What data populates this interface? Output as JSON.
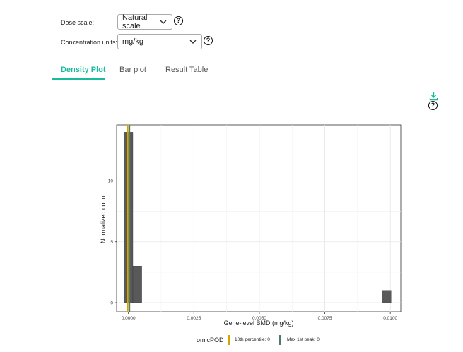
{
  "controls": {
    "dose_scale": {
      "label": "Dose scale:",
      "value": "Natural scale"
    },
    "concentration_units": {
      "label": "Concentration units:",
      "value": "mg/kg"
    },
    "help_glyph": "?"
  },
  "tabs": [
    {
      "label": "Density Plot",
      "active": true
    },
    {
      "label": "Bar plot",
      "active": false
    },
    {
      "label": "Result Table",
      "active": false
    }
  ],
  "icons": {
    "download": "download-icon",
    "help": "question-circle-icon",
    "chevron": "chevron-down-icon"
  },
  "colors": {
    "accent": "#18bc9c",
    "bar": "#595959",
    "tenth_percentile": "#d4a400",
    "max_first_peak": "#4d7a6a"
  },
  "chart_data": {
    "type": "bar",
    "title": "",
    "xlabel": "Gene-level BMD (mg/kg)",
    "ylabel": "Normalized count",
    "xlim": [
      -0.00045,
      0.0104
    ],
    "ylim": [
      -0.75,
      14.6
    ],
    "x_ticks": [
      0.0,
      0.0025,
      0.005,
      0.0075,
      0.01
    ],
    "x_tick_labels": [
      "0.0000",
      "0.0025",
      "0.0050",
      "0.0075",
      "0.0100"
    ],
    "y_ticks": [
      0,
      5,
      10
    ],
    "y_tick_labels": [
      "0",
      "5",
      "10"
    ],
    "grid": true,
    "bin_width": 0.00034,
    "bins": [
      {
        "x": 0.0,
        "count": 14
      },
      {
        "x": 0.00034,
        "count": 3
      },
      {
        "x": 0.00986,
        "count": 1
      }
    ],
    "vlines": [
      {
        "name": "10th percentile",
        "x": 0.0,
        "color": "#d4a400"
      },
      {
        "name": "Max 1st peak",
        "x": 0.0,
        "color": "#4d7a6a"
      }
    ],
    "legend": {
      "title": "omicPOD",
      "placement": "bottom",
      "entries": [
        "10th percentile: 0",
        "Max 1st peak: 0"
      ]
    }
  }
}
